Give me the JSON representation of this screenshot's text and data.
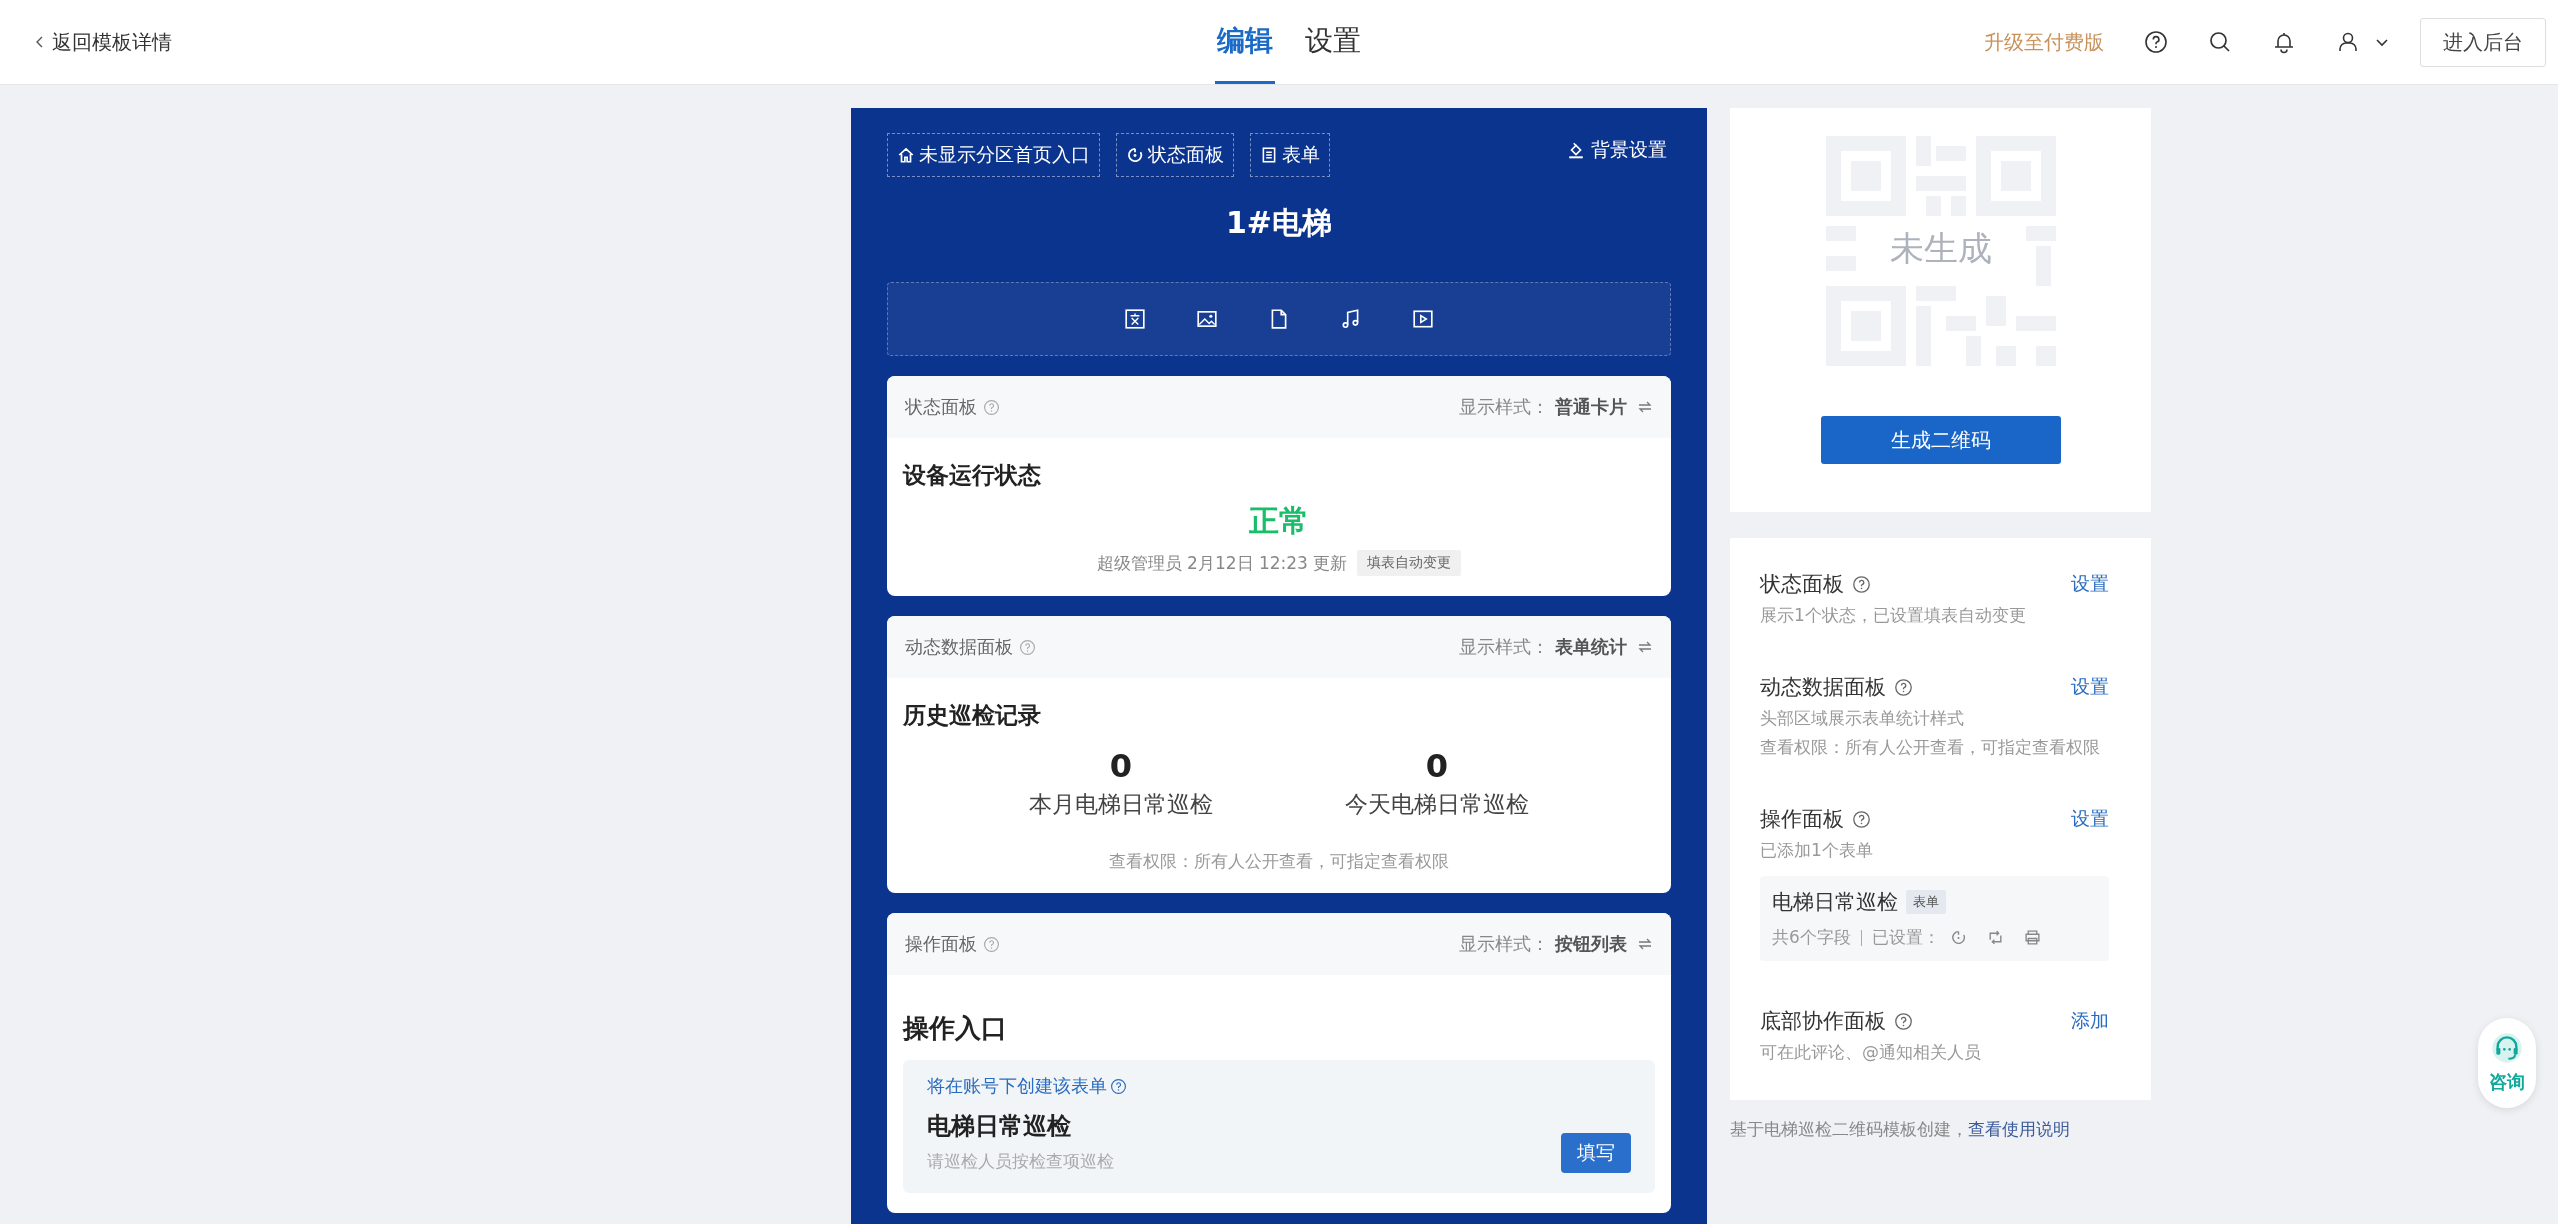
{
  "header": {
    "back_link": "返回模板详情",
    "tabs": [
      {
        "label": "编辑",
        "selected": true
      },
      {
        "label": "设置",
        "selected": false
      }
    ],
    "upgrade_link": "升级至付费版",
    "admin_button": "进入后台"
  },
  "editor": {
    "chips": [
      {
        "kind": "home",
        "label": "未显示分区首页入口"
      },
      {
        "kind": "status",
        "label": "状态面板"
      },
      {
        "kind": "form",
        "label": "表单"
      }
    ],
    "background_button": "背景设置",
    "title": "1#电梯",
    "panels": [
      {
        "kind": "status",
        "label": "状态面板",
        "style_label": "显示样式：",
        "style_value": "普通卡片",
        "heading": "设备运行状态",
        "status": "正常",
        "meta": "超级管理员 2月12日 12:23 更新",
        "tag": "填表自动变更"
      },
      {
        "kind": "stats",
        "label": "动态数据面板",
        "style_label": "显示样式：",
        "style_value": "表单统计",
        "heading": "历史巡检记录",
        "stats": [
          {
            "value": "0",
            "label": "本月电梯日常巡检"
          },
          {
            "value": "0",
            "label": "今天电梯日常巡检"
          }
        ],
        "note": "查看权限：所有人公开查看，可指定查看权限"
      },
      {
        "kind": "actions",
        "label": "操作面板",
        "style_label": "显示样式：",
        "style_value": "按钮列表",
        "heading": "操作入口",
        "hint": "将在账号下创建该表单",
        "form_title": "电梯日常巡检",
        "form_desc": "请巡检人员按检查项巡检",
        "form_button": "填写"
      }
    ]
  },
  "qr": {
    "placeholder_text": "未生成",
    "button": "生成二维码"
  },
  "settings": [
    {
      "title": "状态面板",
      "action": "设置",
      "lines": [
        "展示1个状态，已设置填表自动变更"
      ]
    },
    {
      "title": "动态数据面板",
      "action": "设置",
      "lines": [
        "头部区域展示表单统计样式",
        "查看权限：所有人公开查看，可指定查看权限"
      ]
    },
    {
      "title": "操作面板",
      "action": "设置",
      "lines": [
        "已添加1个表单"
      ],
      "form": {
        "name": "电梯日常巡检",
        "tag": "表单",
        "fields": "共6个字段",
        "configured": "已设置："
      }
    },
    {
      "title": "底部协作面板",
      "action": "添加",
      "lines": [
        "可在此评论、@通知相关人员"
      ]
    }
  ],
  "footer": {
    "text": "基于电梯巡检二维码模板创建，",
    "link": "查看使用说明"
  },
  "consult_button": "咨询"
}
